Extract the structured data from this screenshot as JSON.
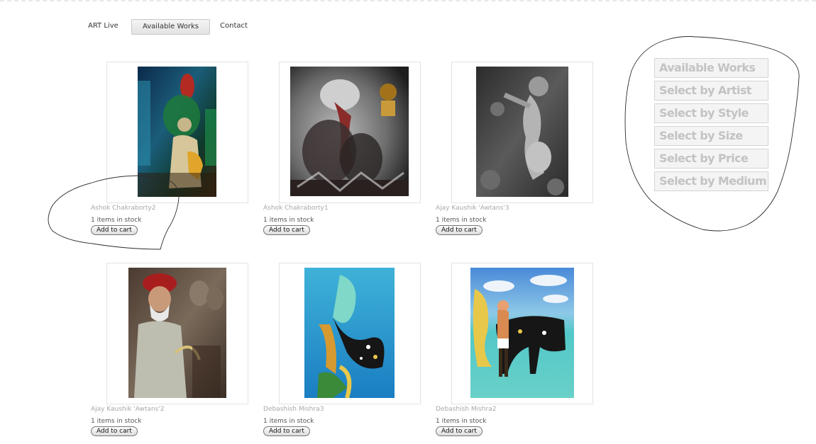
{
  "nav": {
    "items": [
      {
        "label": "ART Live",
        "active": false
      },
      {
        "label": "Available Works",
        "active": true
      },
      {
        "label": "Contact",
        "active": false
      }
    ]
  },
  "products": [
    {
      "title": "Ashok Chakraborty2",
      "stock": "1 items in stock",
      "cart_label": "Add to cart"
    },
    {
      "title": "Ashok Chakraborty1",
      "stock": "1 items in stock",
      "cart_label": "Add to cart"
    },
    {
      "title": "Ajay Kaushik 'Awtans'3",
      "stock": "1 items in stock",
      "cart_label": "Add to cart"
    },
    {
      "title": "Ajay Kaushik 'Awtans'2",
      "stock": "1 items in stock",
      "cart_label": "Add to cart"
    },
    {
      "title": "Debashish Mishra3",
      "stock": "1 items in stock",
      "cart_label": "Add to cart"
    },
    {
      "title": "Debashish Mishra2",
      "stock": "1 items in stock",
      "cart_label": "Add to cart"
    }
  ],
  "filter_menu": {
    "items": [
      "Available Works",
      "Select by Artist",
      "Select by Style",
      "Select by Size",
      "Select by Price",
      "Select by Medium"
    ]
  }
}
